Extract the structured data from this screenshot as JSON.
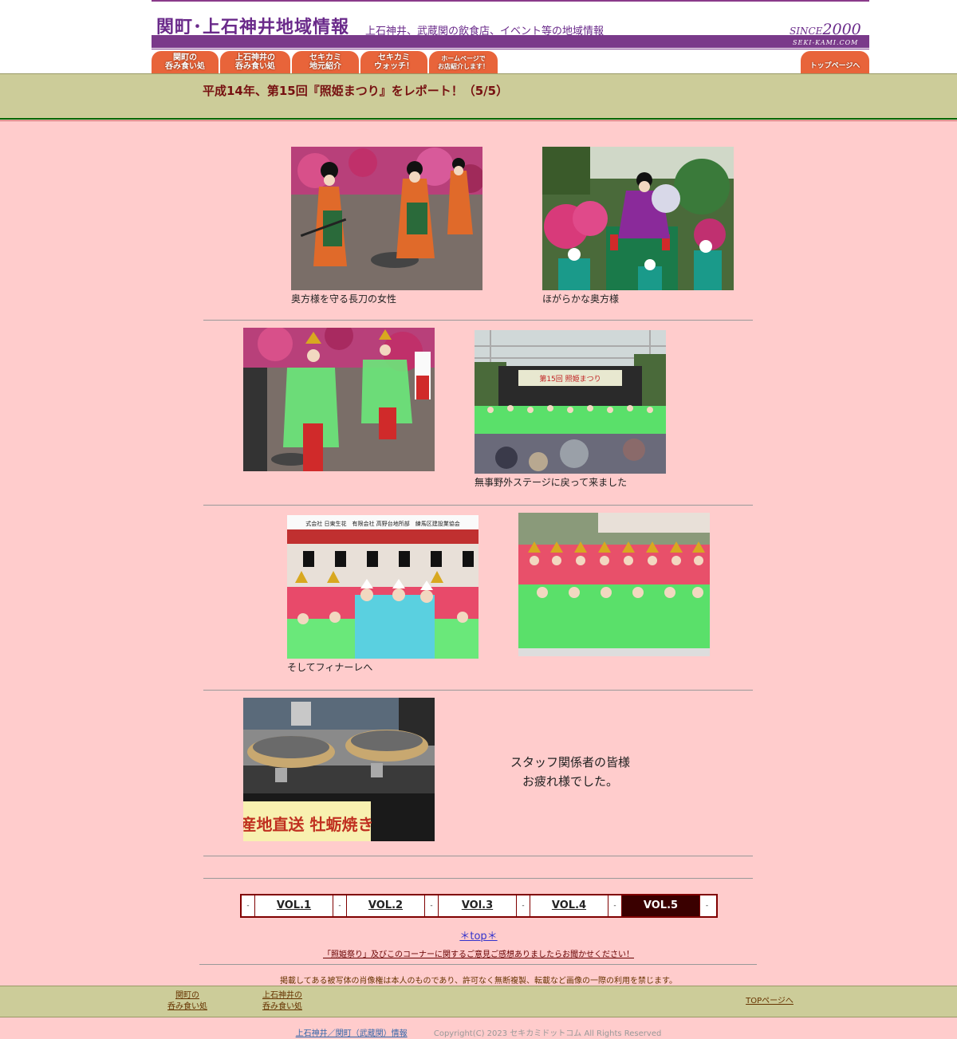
{
  "header": {
    "site_title": "関町･上石神井地域情報",
    "site_subtitle": "上石神井、武蔵関の飲食店、イベント等の地域情報",
    "since_prefix": "SINCE",
    "since_year": "2000",
    "domain": "SEKI-KAMI.COM"
  },
  "nav": {
    "tab1_line1": "関町の",
    "tab1_line2": "呑み食い処",
    "tab2_line1": "上石神井の",
    "tab2_line2": "呑み食い処",
    "tab3_line1": "セキカミ",
    "tab3_line2": "地元紹介",
    "tab4_line1": "セキカミ",
    "tab4_line2": "ウォッチ！",
    "tab5_line1": "ホームページで",
    "tab5_line2": "お店紹介します！",
    "top_tab": "トップページへ"
  },
  "page_title": "平成14年、第15回『照姫まつり』をレポート！（5/5）",
  "captions": {
    "photo1": "奥方様を守る長刀の女性",
    "photo2": "ほがらかな奥方様",
    "photo4": "無事野外ステージに戻って来ました",
    "photo5": "そしてフィナーレへ"
  },
  "thanks": {
    "line1": "スタッフ関係者の皆様",
    "line2": "お疲れ様でした。"
  },
  "signs": {
    "banner": "第15回 照姫まつり",
    "stage_banner": "式会社 日東生花　有限会社 高野台地所部　練馬区建設業協会",
    "food_sign": "産地直送 牡蛎焼き"
  },
  "vol_nav": {
    "sep": "-",
    "vol1": "VOL.1",
    "vol2": "VOL.2",
    "vol3": "VOl.3",
    "vol4": "VOL.4",
    "vol5": "VOL.5"
  },
  "totop": "＊top＊",
  "feedback": "「照姫祭り」及びこのコーナーに関するご意見ご感想ありましたらお聞かせください！",
  "notice": "掲載してある被写体の肖像権は本人のものであり、許可なく無断複製、転載など画像の一際の利用を禁じます。",
  "footer": {
    "link1_line1": "関町の",
    "link1_line2": "呑み食い処",
    "link2_line1": "上石神井の",
    "link2_line2": "呑み食い処",
    "top_link": "TOPページへ",
    "bottom_link": "上石神井／関町（武蔵関）情報",
    "copyright": "Copyright(C) 2023 セキカミドットコム All Rights Reserved"
  }
}
